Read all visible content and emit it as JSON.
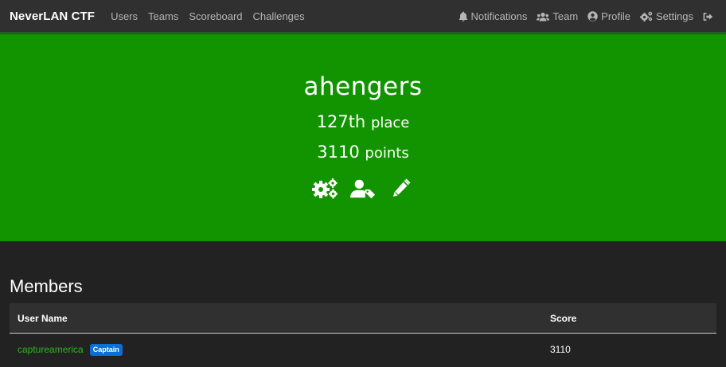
{
  "navbar": {
    "brand": "NeverLAN CTF",
    "left_links": [
      "Users",
      "Teams",
      "Scoreboard",
      "Challenges"
    ],
    "right_links": [
      {
        "label": "Notifications",
        "icon": "bell-icon"
      },
      {
        "label": "Team",
        "icon": "users-icon"
      },
      {
        "label": "Profile",
        "icon": "user-circle-icon"
      },
      {
        "label": "Settings",
        "icon": "cogs-icon"
      }
    ],
    "logout_icon": "sign-out-icon"
  },
  "hero": {
    "team_name": "ahengers",
    "place_number": "127th",
    "place_label": "place",
    "points_number": "3110",
    "points_label": "points",
    "action_icons": [
      "cogs-icon",
      "user-tag-icon",
      "pencil-icon"
    ]
  },
  "members": {
    "title": "Members",
    "columns": [
      "User Name",
      "Score"
    ],
    "rows": [
      {
        "user": "captureamerica",
        "badge": "Captain",
        "score": "3110"
      }
    ]
  },
  "colors": {
    "hero_bg": "#129400",
    "navbar_bg": "#303030",
    "page_bg": "#222222",
    "link_green": "#2bb81f",
    "badge_blue": "#0a6fd6"
  }
}
